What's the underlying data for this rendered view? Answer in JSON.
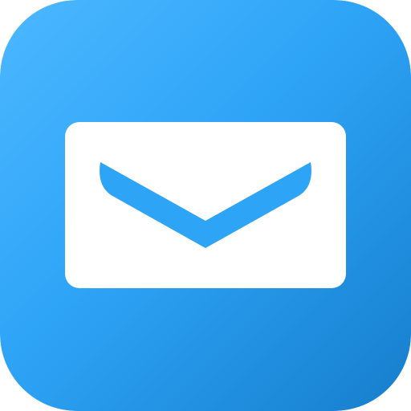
{
  "icon": {
    "name": "mail-icon",
    "colors": {
      "gradient_start": "#4CB8FF",
      "gradient_mid": "#2EA4F7",
      "gradient_end": "#167ECC",
      "envelope_fill": "#FFFFFF",
      "flap_stroke": "#2EA4F7"
    }
  }
}
